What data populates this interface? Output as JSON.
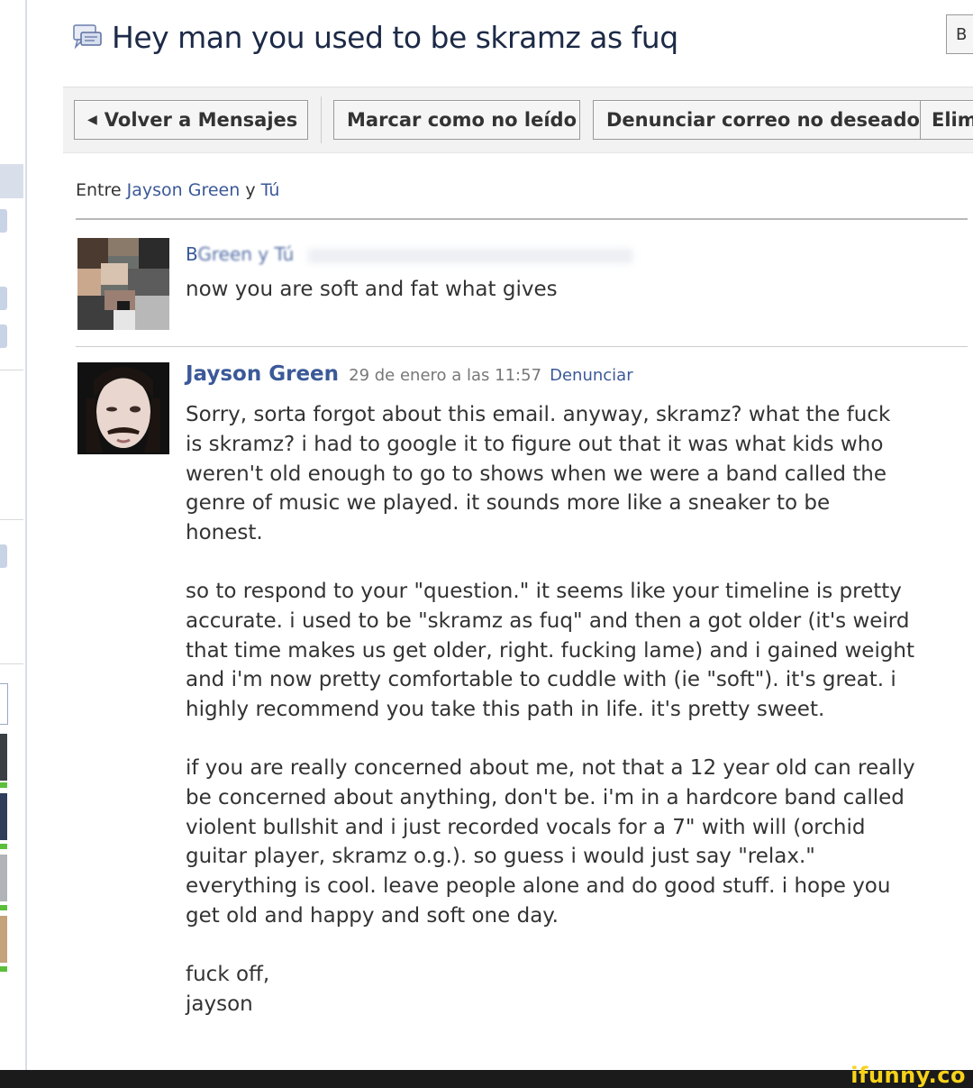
{
  "header": {
    "title": "Hey man you used to be skramz as fuq",
    "corner_button_label": "B"
  },
  "toolbar": {
    "back_label": "Volver a Mensajes",
    "mark_unread_label": "Marcar como no leído",
    "report_spam_label": "Denunciar correo no deseado",
    "delete_label": "Elim"
  },
  "thread": {
    "between_prefix": "Entre",
    "participant": "Jayson Green",
    "conj": "y",
    "you": "Tú"
  },
  "messages": [
    {
      "sender_initial": "B",
      "meta": "Green y Tú",
      "text": "now you are soft and fat what gives"
    },
    {
      "author": "Jayson Green",
      "date": "29 de enero a las 11:57",
      "report_label": "Denunciar",
      "lines": [
        "Sorry, sorta forgot about this email. anyway, skramz? what the fuck",
        "is skramz? i had to google it to figure out that it was what kids who",
        "weren't old enough to go to shows when we were a band called the",
        "genre of music we played. it sounds more like a sneaker to be",
        "honest.",
        "",
        "so to respond to your \"question.\" it seems like your timeline is pretty",
        "accurate. i used to be \"skramz as fuq\" and then a got older (it's weird",
        "that time makes us get older, right. fucking lame) and i gained weight",
        "and i'm now pretty comfortable to cuddle with (ie \"soft\"). it's great. i",
        "highly recommend you take this path in life. it's pretty sweet.",
        "",
        "if you are really concerned about me, not that a 12 year old can really",
        "be concerned about anything, don't be. i'm in a hardcore band called",
        "violent bullshit and i just recorded vocals for a 7\" with will (orchid",
        "guitar player, skramz o.g.). so guess i would just say \"relax.\"",
        "everything is cool. leave people alone and do good stuff. i hope you",
        "get old and happy and soft one day.",
        "",
        "fuck off,",
        "jayson"
      ]
    }
  ],
  "watermark": "ifunny.co",
  "colors": {
    "link": "#3b5998",
    "title": "#1c2a47",
    "toolbar_bg": "#f2f2f2",
    "watermark": "#f7d21a"
  }
}
